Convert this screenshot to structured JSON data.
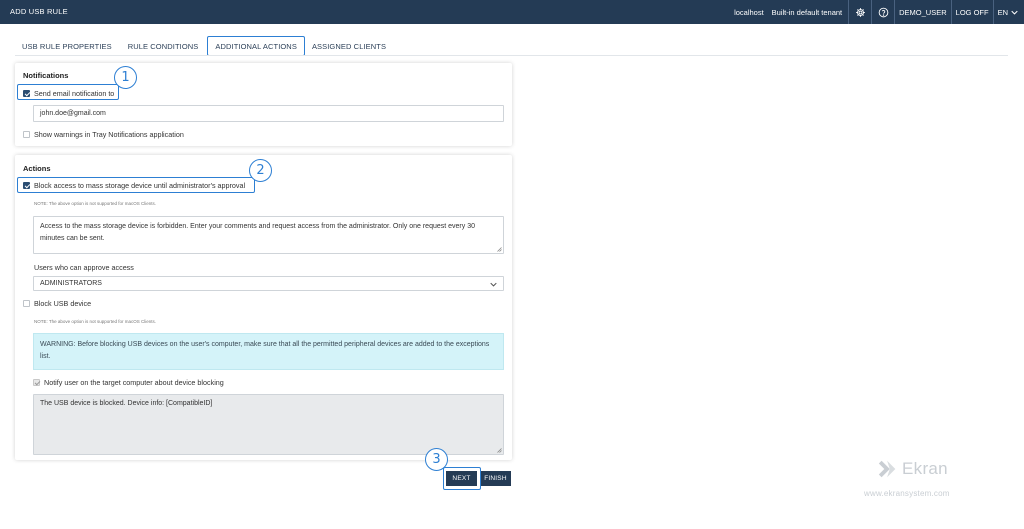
{
  "header": {
    "title": "ADD USB RULE",
    "server": "localhost",
    "tenant": "Built-in default tenant",
    "user": "DEMO_USER",
    "logoff": "LOG OFF",
    "language": "EN",
    "bg_color": "#243b55"
  },
  "tabs": [
    {
      "label": "USB RULE PROPERTIES"
    },
    {
      "label": "RULE CONDITIONS"
    },
    {
      "label": "ADDITIONAL ACTIONS",
      "active": true
    },
    {
      "label": "ASSIGNED CLIENTS"
    }
  ],
  "notifications": {
    "title": "Notifications",
    "send_email_label": "Send email notification to",
    "send_email_checked": true,
    "email_value": "john.doe@gmail.com",
    "tray_label": "Show warnings in Tray Notifications application",
    "tray_checked": false
  },
  "actions": {
    "title": "Actions",
    "block_mass_label": "Block access to mass storage device until administrator's approval",
    "block_mass_checked": true,
    "note1": "NOTE: The above option is not supported for macOS Clients.",
    "message_text": "Access to the mass storage device is forbidden. Enter your comments and request access from the administrator. Only one request every 30 minutes can be sent.",
    "approvers_label": "Users who can approve access",
    "approvers_value": "ADMINISTRATORS",
    "block_usb_label": "Block USB device",
    "block_usb_checked": false,
    "note2": "NOTE: The above option is not supported for macOS Clients.",
    "warning_text": "WARNING: Before blocking USB devices on the user's computer, make sure that all the permitted peripheral devices are added to the exceptions list.",
    "notify_label": "Notify user on the target computer about device blocking",
    "notify_checked": true,
    "blocked_message": "The USB device is blocked. Device info: [CompatibleID]"
  },
  "callouts": [
    "1",
    "2",
    "3"
  ],
  "buttons": {
    "next": "NEXT",
    "finish": "FINISH"
  },
  "watermark": {
    "name": "Ekran",
    "url": "www.ekransystem.com"
  },
  "colors": {
    "accent": "#2d7fd3",
    "warning_bg": "#d4f3f9"
  }
}
